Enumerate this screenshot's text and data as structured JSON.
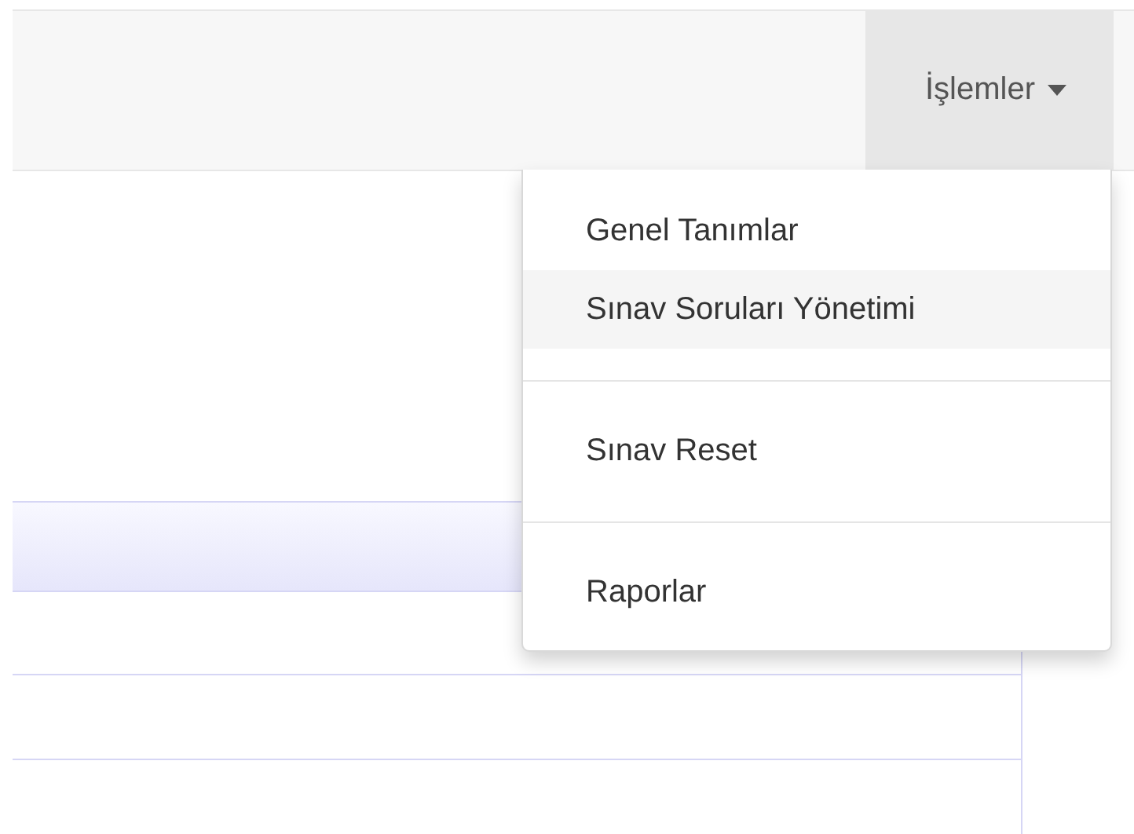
{
  "navbar": {
    "dropdown": {
      "label": "İşlemler",
      "open": true,
      "items": [
        {
          "kind": "item",
          "label": "Genel Tanımlar",
          "selected": false
        },
        {
          "kind": "item",
          "label": "Sınav Soruları Yönetimi",
          "selected": true
        },
        {
          "kind": "divider"
        },
        {
          "kind": "item",
          "label": "Sınav Reset",
          "selected": false
        },
        {
          "kind": "divider"
        },
        {
          "kind": "item",
          "label": "Raporlar",
          "selected": false
        }
      ]
    }
  }
}
